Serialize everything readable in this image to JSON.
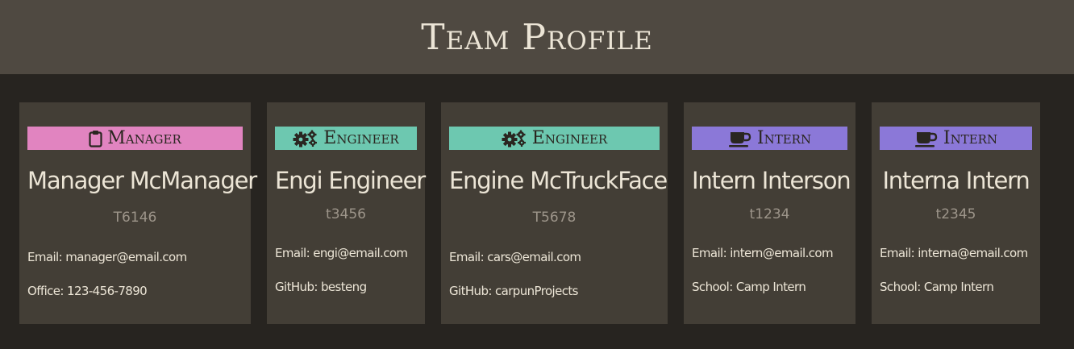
{
  "header": {
    "title": "Team Profile"
  },
  "cards": [
    {
      "role": "Manager",
      "icon": "clipboard-icon",
      "name": "Manager McManager",
      "id": "T6146",
      "line1": "Email: manager@email.com",
      "line2": "Office: 123-456-7890"
    },
    {
      "role": "Engineer",
      "icon": "gears-icon",
      "name": "Engi Engineer",
      "id": "t3456",
      "line1": "Email: engi@email.com",
      "line2": "GitHub: besteng"
    },
    {
      "role": "Engineer",
      "icon": "gears-icon",
      "name": "Engine McTruckFace",
      "id": "T5678",
      "line1": "Email: cars@email.com",
      "line2": "GitHub: carpunProjects"
    },
    {
      "role": "Intern",
      "icon": "coffee-cup-icon",
      "name": "Intern Interson",
      "id": "t1234",
      "line1": "Email: intern@email.com",
      "line2": "School: Camp Intern"
    },
    {
      "role": "Intern",
      "icon": "coffee-cup-icon",
      "name": "Interna Intern",
      "id": "t2345",
      "line1": "Email: interna@email.com",
      "line2": "School: Camp Intern"
    }
  ],
  "colors": {
    "header_bg": "#4f4941",
    "page_bg": "#272420",
    "card_bg": "#433e36",
    "manager_badge": "#e184c0",
    "engineer_badge": "#6dc8b0",
    "intern_badge": "#8b78d8"
  }
}
